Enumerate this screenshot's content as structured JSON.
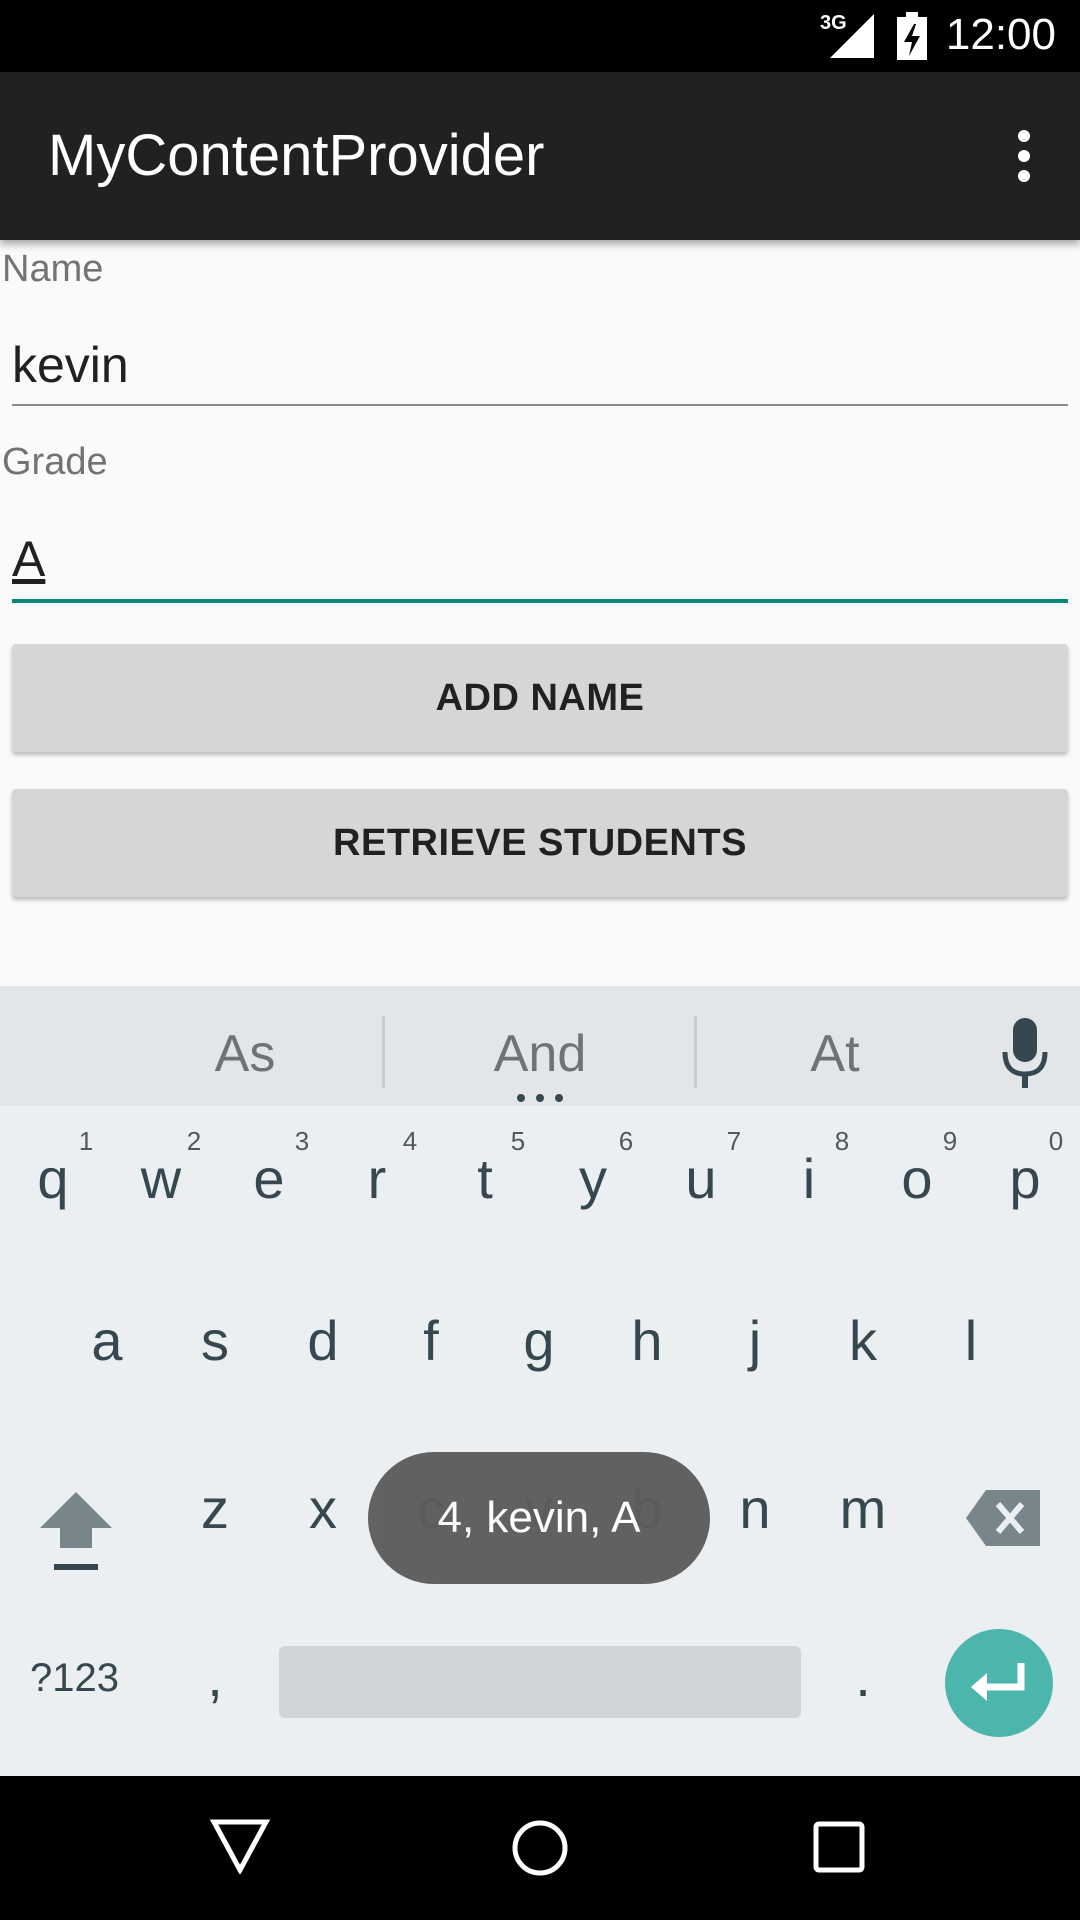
{
  "status_bar": {
    "network": "3G",
    "time": "12:00"
  },
  "app_bar": {
    "title": "MyContentProvider"
  },
  "form": {
    "name_label": "Name",
    "name_value": "kevin",
    "grade_label": "Grade",
    "grade_value": "A"
  },
  "buttons": {
    "add_name": "ADD NAME",
    "retrieve_students": "RETRIEVE STUDENTS"
  },
  "keyboard": {
    "suggestions": [
      "As",
      "And",
      "At"
    ],
    "row1": [
      "q",
      "w",
      "e",
      "r",
      "t",
      "y",
      "u",
      "i",
      "o",
      "p"
    ],
    "row1_hints": [
      "1",
      "2",
      "3",
      "4",
      "5",
      "6",
      "7",
      "8",
      "9",
      "0"
    ],
    "row2": [
      "a",
      "s",
      "d",
      "f",
      "g",
      "h",
      "j",
      "k",
      "l"
    ],
    "row3": [
      "z",
      "x",
      "c",
      "v",
      "b",
      "n",
      "m"
    ],
    "symbols_label": "?123",
    "comma": ",",
    "period": "."
  },
  "toast": {
    "text": "4, kevin, A"
  },
  "colors": {
    "accent": "#00897b",
    "enter_key": "#4db6ac",
    "app_bar": "#212121"
  }
}
